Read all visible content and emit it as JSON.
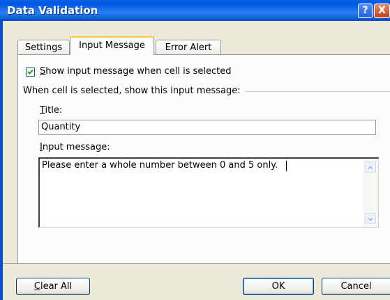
{
  "window": {
    "title": "Data Validation",
    "help_label": "?",
    "close_label": "X"
  },
  "tabs": [
    {
      "label": "Settings",
      "active": false
    },
    {
      "label": "Input Message",
      "active": true
    },
    {
      "label": "Error Alert",
      "active": false
    }
  ],
  "input_message": {
    "show_checkbox_checked": true,
    "show_checkbox_label": "how input message when cell is selected",
    "show_checkbox_mnemonic": "S",
    "group_label": "When cell is selected, show this input message:",
    "title_label_mnemonic": "T",
    "title_label_rest": "itle:",
    "title_value": "Quantity",
    "message_label_mnemonic": "I",
    "message_label_rest": "nput message:",
    "message_value": "Please enter a whole number between 0 and 5 only."
  },
  "buttons": {
    "clear_all_mnemonic": "C",
    "clear_all_rest": "lear All",
    "ok": "OK",
    "cancel": "Cancel"
  },
  "colors": {
    "titlebar": "#0058e6",
    "dialog_bg": "#ece9d8",
    "panel_bg": "#fcfcfe",
    "active_tab_accent": "#ffc83c"
  }
}
